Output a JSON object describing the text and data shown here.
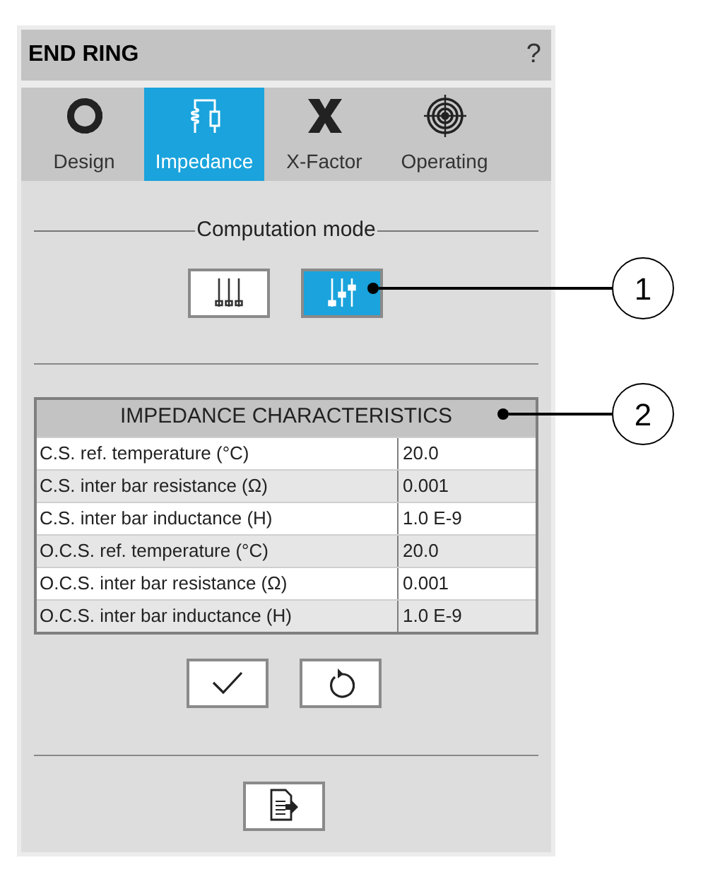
{
  "window": {
    "title": "END RING",
    "help": "?"
  },
  "tabs": [
    {
      "label": "Design",
      "kind": "ring",
      "selected": false
    },
    {
      "label": "Impedance",
      "kind": "circuit",
      "selected": true
    },
    {
      "label": "X-Factor",
      "kind": "x",
      "selected": false
    },
    {
      "label": "Operating",
      "kind": "target",
      "selected": false
    }
  ],
  "computation_mode": {
    "label": "Computation mode",
    "options": [
      {
        "kind": "aligned",
        "selected": false
      },
      {
        "kind": "mixed",
        "selected": true
      }
    ]
  },
  "table": {
    "title": "IMPEDANCE CHARACTERISTICS",
    "rows": [
      {
        "label": "C.S. ref. temperature (°C)",
        "value": "20.0"
      },
      {
        "label": "C.S. inter bar resistance (Ω)",
        "value": "0.001"
      },
      {
        "label": "C.S. inter bar inductance (H)",
        "value": "1.0 E-9"
      },
      {
        "label": "O.C.S. ref. temperature (°C)",
        "value": "20.0"
      },
      {
        "label": "O.C.S. inter bar resistance (Ω)",
        "value": "0.001"
      },
      {
        "label": "O.C.S. inter bar inductance (H)",
        "value": "1.0 E-9"
      }
    ]
  },
  "actions": [
    {
      "kind": "apply"
    },
    {
      "kind": "reset"
    }
  ],
  "footer_actions": [
    {
      "kind": "export"
    }
  ],
  "callouts": [
    {
      "label": "1"
    },
    {
      "label": "2"
    }
  ]
}
